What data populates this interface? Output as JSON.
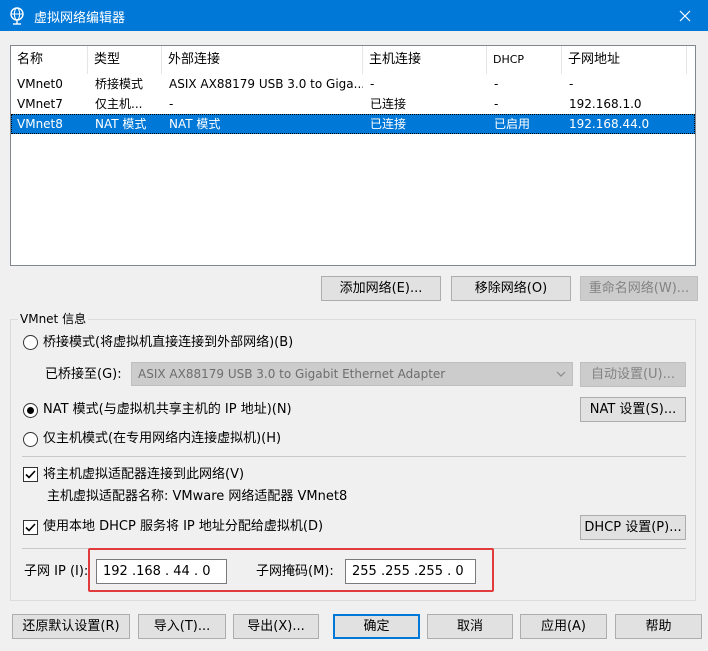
{
  "window": {
    "title": "虚拟网络编辑器"
  },
  "table": {
    "columns": [
      "名称",
      "类型",
      "外部连接",
      "主机连接",
      "DHCP",
      "子网地址"
    ],
    "rows": [
      {
        "name": "VMnet0",
        "type": "桥接模式",
        "external": "ASIX AX88179 USB 3.0 to Giga...",
        "host": "-",
        "dhcp": "-",
        "subnet": "-"
      },
      {
        "name": "VMnet7",
        "type": "仅主机...",
        "external": "-",
        "host": "已连接",
        "dhcp": "-",
        "subnet": "192.168.1.0"
      },
      {
        "name": "VMnet8",
        "type": "NAT 模式",
        "external": "NAT 模式",
        "host": "已连接",
        "dhcp": "已启用",
        "subnet": "192.168.44.0"
      }
    ]
  },
  "table_buttons": {
    "add": "添加网络(E)...",
    "remove": "移除网络(O)",
    "rename": "重命名网络(W)..."
  },
  "vmnet_info": {
    "title": "VMnet 信息",
    "bridge_label": "桥接模式(将虚拟机直接连接到外部网络)(B)",
    "bridged_to_label": "已桥接至(G):",
    "bridged_to_value": "ASIX AX88179 USB 3.0 to Gigabit Ethernet Adapter",
    "auto_settings": "自动设置(U)...",
    "nat_label": "NAT 模式(与虚拟机共享主机的 IP 地址)(N)",
    "nat_settings": "NAT 设置(S)...",
    "hostonly_label": "仅主机模式(在专用网络内连接虚拟机)(H)",
    "connect_adapter_label": "将主机虚拟适配器连接到此网络(V)",
    "adapter_name_label": "主机虚拟适配器名称: VMware 网络适配器 VMnet8",
    "dhcp_label": "使用本地 DHCP 服务将 IP 地址分配给虚拟机(D)",
    "dhcp_settings": "DHCP 设置(P)...",
    "subnet_ip_label": "子网 IP (I):",
    "subnet_ip_value": "192 .168 . 44  .  0",
    "subnet_mask_label": "子网掩码(M):",
    "subnet_mask_value": "255 .255 .255 .  0"
  },
  "footer": {
    "restore": "还原默认设置(R)",
    "import": "导入(T)...",
    "export": "导出(X)...",
    "ok": "确定",
    "cancel": "取消",
    "apply": "应用(A)",
    "help": "帮助"
  },
  "colors": {
    "titlebar": "#0078d7",
    "selection": "#0078d7",
    "highlight_box": "#e23b3b"
  }
}
